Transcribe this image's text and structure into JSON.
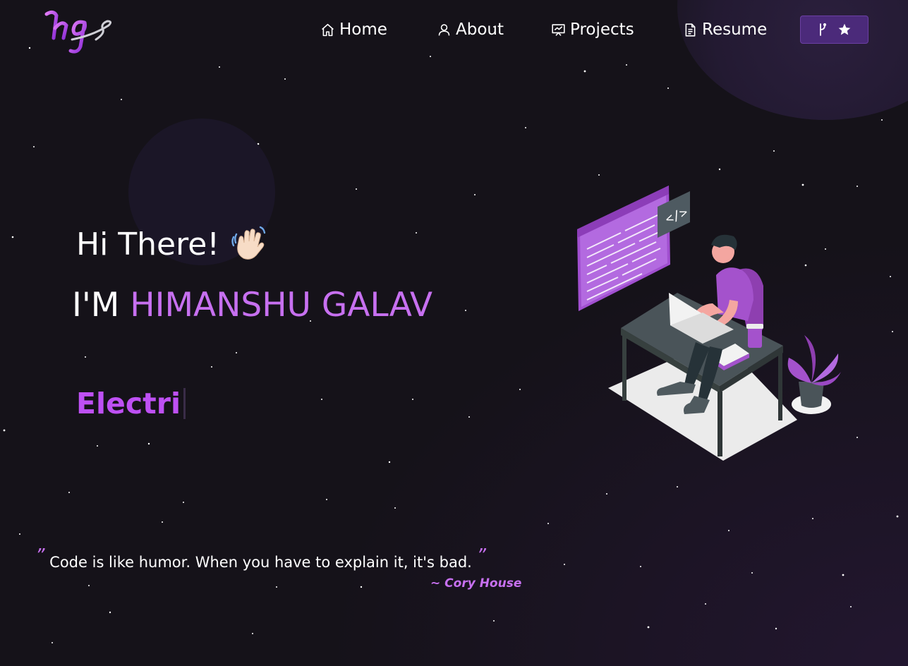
{
  "brand": {
    "logo_text": "hg",
    "accent_color": "#c770f0",
    "background_color": "#151219"
  },
  "nav": {
    "items": [
      {
        "label": "Home",
        "icon": "home-icon"
      },
      {
        "label": "About",
        "icon": "user-icon"
      },
      {
        "label": "Projects",
        "icon": "presentation-icon"
      },
      {
        "label": "Resume",
        "icon": "document-icon"
      }
    ],
    "fork_button": {
      "icons": [
        "git-fork-icon",
        "star-icon"
      ]
    }
  },
  "hero": {
    "greeting": "Hi There!",
    "greeting_emoji": "waving-hand-icon",
    "intro_prefix": "I'M",
    "name": "HIMANSHU GALAV",
    "typewriter_text": "Electri",
    "illustration": "developer-at-desk-illustration"
  },
  "quote": {
    "open_mark": "”",
    "text": "Code is like humor. When you have to explain it, it's bad.",
    "close_mark": "”",
    "author": "~ Cory House"
  }
}
